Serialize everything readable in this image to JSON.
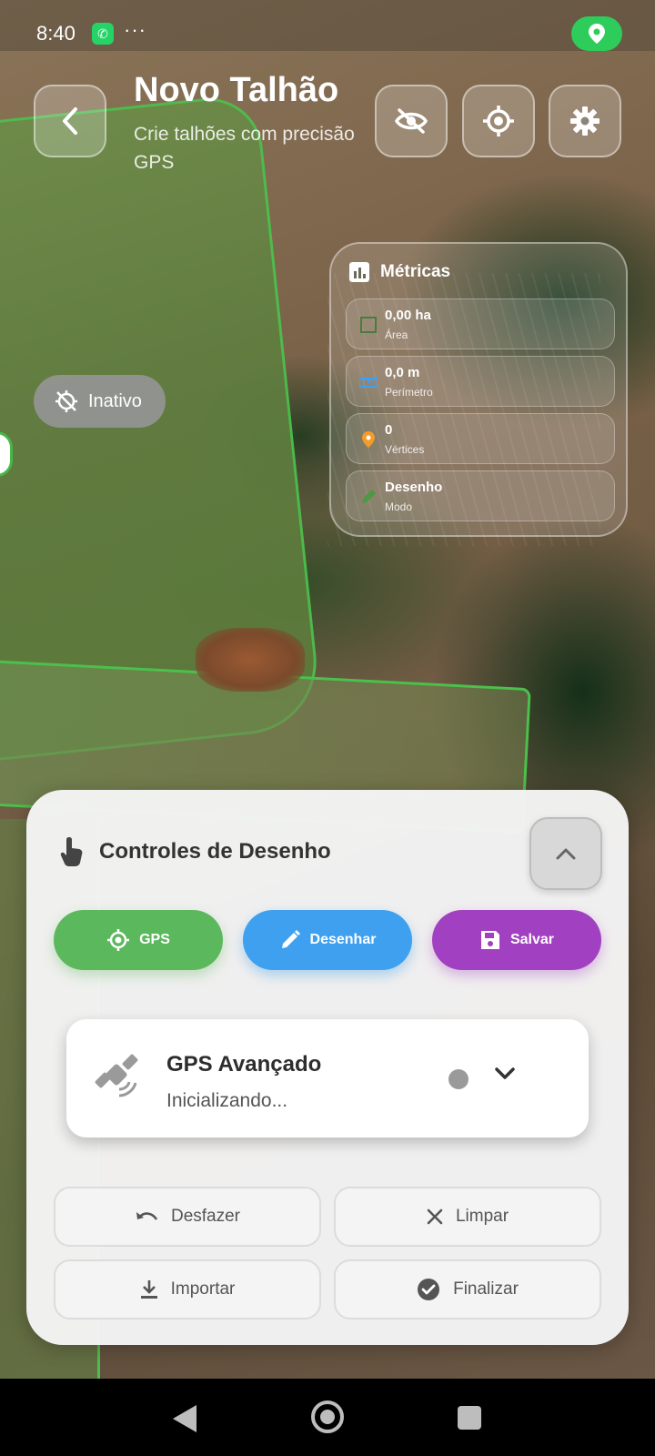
{
  "status_bar": {
    "time": "8:40",
    "notification_dots": "···"
  },
  "header": {
    "title": "Novo Talhão",
    "subtitle": "Crie talhões com precisão GPS"
  },
  "gps_chip": {
    "label": "Inativo"
  },
  "metrics": {
    "title": "Métricas",
    "items": [
      {
        "value": "0,00 ha",
        "label": "Área",
        "icon": "area-icon"
      },
      {
        "value": "0,0 m",
        "label": "Perímetro",
        "icon": "ruler-icon"
      },
      {
        "value": "0",
        "label": "Vértices",
        "icon": "pin-icon"
      },
      {
        "value": "Desenho",
        "label": "Modo",
        "icon": "pencil-icon"
      }
    ]
  },
  "panel": {
    "title": "Controles de Desenho",
    "actions": {
      "gps": "GPS",
      "draw": "Desenhar",
      "save": "Salvar"
    },
    "gps_card": {
      "title": "GPS Avançado",
      "status": "Inicializando..."
    },
    "buttons": {
      "undo": "Desfazer",
      "clear": "Limpar",
      "import": "Importar",
      "finish": "Finalizar"
    }
  },
  "colors": {
    "gps_button": "#5cb85c",
    "draw_button": "#3ea0ee",
    "save_button": "#a140c0",
    "field_outline": "#4cc04c",
    "location_badge": "#2ecc5a"
  }
}
